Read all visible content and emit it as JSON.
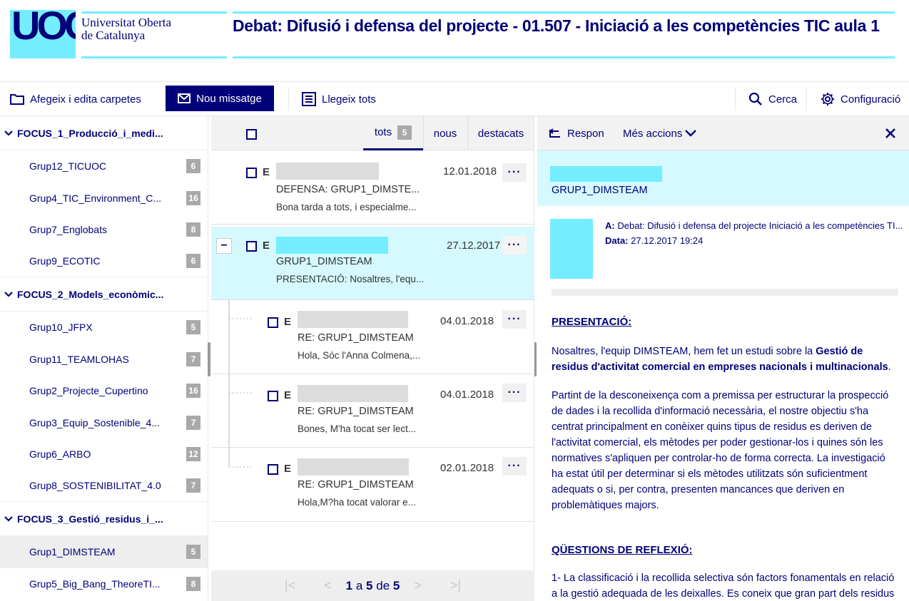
{
  "header": {
    "logo_text": "UOC",
    "university_line1": "Universitat Oberta",
    "university_line2": "de Catalunya",
    "title": "Debat: Difusió i defensa del projecte - 01.507 - Iniciació a les competències TIC aula 1"
  },
  "toolbar": {
    "folders_label": "Afegeix i edita carpetes",
    "new_message_label": "Nou missatge",
    "read_all_label": "Llegeix tots",
    "search_label": "Cerca",
    "settings_label": "Configuració"
  },
  "sidebar": {
    "folders": [
      {
        "name": "FOCUS_1_Producció_i_medi...",
        "groups": [
          {
            "name": "Grup12_TICUOC",
            "count": "6"
          },
          {
            "name": "Grup4_TIC_Environment_C...",
            "count": "16"
          },
          {
            "name": "Grup7_Englobats",
            "count": "8"
          },
          {
            "name": "Grup9_ECOTIC",
            "count": "6"
          }
        ]
      },
      {
        "name": "FOCUS_2_Models_econòmic...",
        "groups": [
          {
            "name": "Grup10_JFPX",
            "count": "5"
          },
          {
            "name": "Grup11_TEAMLOHAS",
            "count": "7"
          },
          {
            "name": "Grup2_Projecte_Cupertino",
            "count": "16"
          },
          {
            "name": "Grup3_Equip_Sostenible_4...",
            "count": "7"
          },
          {
            "name": "Grup6_ARBO",
            "count": "12"
          },
          {
            "name": "Grup8_SOSTENIBILITAT_4.0",
            "count": "7"
          }
        ]
      },
      {
        "name": "FOCUS_3_Gestió_residus_i_...",
        "groups": [
          {
            "name": "Grup1_DIMSTEAM",
            "count": "5"
          },
          {
            "name": "Grup5_Big_Bang_TheoreTI...",
            "count": "8"
          }
        ]
      }
    ]
  },
  "list": {
    "tabs": {
      "all": "tots",
      "all_count": "5",
      "new": "nous",
      "starred": "destacats"
    },
    "messages": [
      {
        "flag": "E",
        "date": "12.01.2018",
        "subject": "DEFENSA: GRUP1_DIMSTE...",
        "preview": "Bona tarda a tots, i especialme...",
        "more": "···"
      },
      {
        "flag": "E",
        "date": "27.12.2017",
        "subject": "GRUP1_DIMSTEAM",
        "preview": "PRESENTACIÓ: Nosaltres, l'equ...",
        "more": "···",
        "collapse": "−"
      },
      {
        "flag": "E",
        "date": "04.01.2018",
        "subject": "RE: GRUP1_DIMSTEAM",
        "preview": "Hola, Sóc l'Anna Colmena,...",
        "more": "···"
      },
      {
        "flag": "E",
        "date": "04.01.2018",
        "subject": "RE: GRUP1_DIMSTEAM",
        "preview": "Bones, M'ha tocat ser lect...",
        "more": "···"
      },
      {
        "flag": "E",
        "date": "02.01.2018",
        "subject": "RE: GRUP1_DIMSTEAM",
        "preview": "Hola,M?ha tocat valorar e...",
        "more": "···"
      }
    ],
    "pager": {
      "first": "|<",
      "prev": "<",
      "from": "1",
      "a": "a",
      "to": "5",
      "de": "de",
      "total": "5",
      "next": ">",
      "last": ">|"
    }
  },
  "reader": {
    "reply_label": "Respon",
    "more_actions_label": "Més accions",
    "sender_group": "GRUP1_DIMSTEAM",
    "to_label": "A:",
    "to_value": "Debat: Difusió i defensa del projecte Iniciació a les competències TI...",
    "date_label": "Data:",
    "date_value": "27.12.2017 19:24",
    "section1_title": "PRESENTACIÓ:",
    "para1_start": "Nosaltres, l'equip DIMSTEAM, hem fet un estudi sobre la ",
    "para1_bold": "Gestió de residus d'activitat comercial en empreses nacionals i multinacionals",
    "para1_end": ".",
    "para2": "Partint de la desconeixença com a premissa per estructurar la prospecció de dades i la recollida d'informació necessària, el nostre objectiu s'ha centrat principalment en conèixer quins tipus de residus es deriven de l'activitat comercial, els mètodes per poder gestionar-los  i quines són les normatives s'apliquen per controlar-ho de forma correcta. La investigació ha estat útil per determinar si els mètodes utilitzats són suficientment adequats o si, per contra, presenten mancances que deriven en problemàtiques majors.",
    "section2_title": "QÜESTIONS DE REFLEXIÓ:",
    "para3": "1- La classificació i la recollida selectiva són factors fonamentals en relació a la gestió adequada de les deixalles. Es coneix que gran part dels residus"
  },
  "colors": {
    "navy": "#000078",
    "cyan": "#73edff",
    "light_cyan": "#d5f9fe",
    "badge_gray": "#a9a9a9"
  }
}
